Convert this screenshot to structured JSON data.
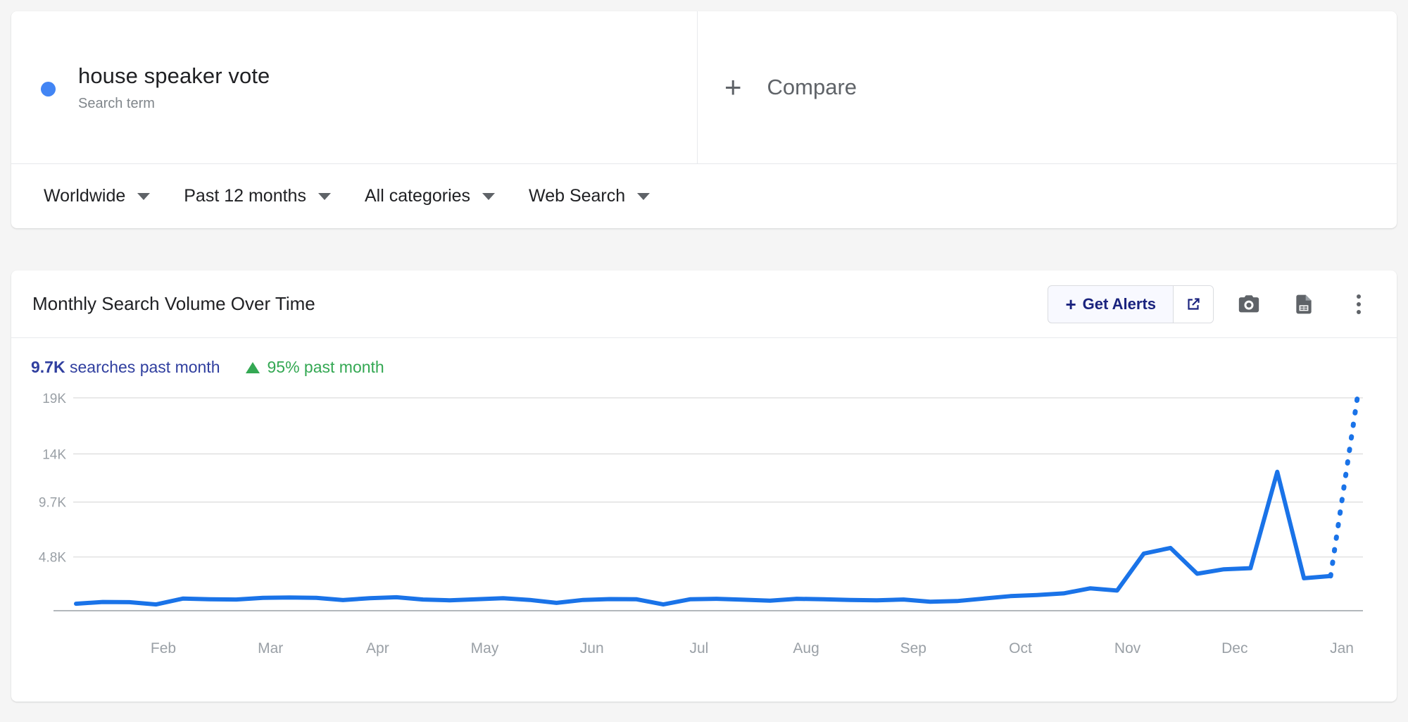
{
  "term": {
    "name": "house speaker vote",
    "type_label": "Search term",
    "dot_color": "#4285f4"
  },
  "compare": {
    "label": "Compare",
    "plus": "+"
  },
  "filters": [
    {
      "label": "Worldwide"
    },
    {
      "label": "Past 12 months"
    },
    {
      "label": "All categories"
    },
    {
      "label": "Web Search"
    }
  ],
  "chart_card": {
    "title": "Monthly Search Volume Over Time",
    "alerts_label": "Get Alerts",
    "alerts_plus": "+",
    "stat_value": "9.7K",
    "stat_suffix": " searches past month",
    "delta_text": "95% past month",
    "accent_color": "#1a73e8",
    "stat_color": "#303f9f",
    "delta_color": "#34a853"
  },
  "chart_data": {
    "type": "line",
    "title": "Monthly Search Volume Over Time",
    "xlabel": "",
    "ylabel": "",
    "ylim": [
      0,
      20500
    ],
    "yticks": [
      "4.8K",
      "9.7K",
      "14K",
      "19K"
    ],
    "ytick_values": [
      4800,
      9700,
      14000,
      19000
    ],
    "grid": true,
    "legend": "none",
    "categories": [
      "Jan",
      "Feb",
      "Mar",
      "Apr",
      "May",
      "Jun",
      "Jul",
      "Aug",
      "Sep",
      "Oct",
      "Nov",
      "Dec",
      "Jan"
    ],
    "xticks": [
      "Feb",
      "Mar",
      "Apr",
      "May",
      "Jun",
      "Jul",
      "Aug",
      "Sep",
      "Oct",
      "Nov",
      "Dec",
      "Jan"
    ],
    "series": [
      {
        "name": "house speaker vote",
        "color": "#1a73e8",
        "values": [
          620,
          780,
          760,
          560,
          1080,
          1020,
          1000,
          1150,
          1180,
          1150,
          950,
          1120,
          1200,
          1000,
          930,
          1020,
          1120,
          960,
          700,
          960,
          1040,
          1020,
          560,
          1020,
          1060,
          980,
          900,
          1060,
          1020,
          960,
          930,
          1000,
          800,
          860,
          1080,
          1300,
          1400,
          1550,
          2000,
          1800,
          5100,
          5600,
          3300,
          3700,
          3800,
          12400,
          2900,
          3100,
          19000
        ],
        "dashed_from_index": 47
      }
    ],
    "annotations": {
      "partial_data_note": "dotted segment indicates incomplete final period"
    }
  }
}
